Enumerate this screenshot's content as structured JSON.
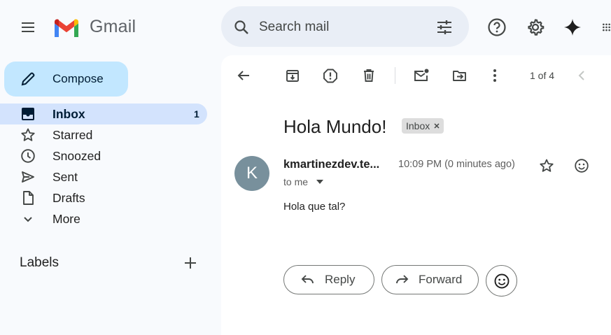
{
  "app": {
    "name": "Gmail"
  },
  "search": {
    "placeholder": "Search mail"
  },
  "compose": {
    "label": "Compose"
  },
  "sidebar": {
    "items": [
      {
        "label": "Inbox",
        "count": "1",
        "icon": "inbox-icon",
        "active": true
      },
      {
        "label": "Starred",
        "icon": "star-icon"
      },
      {
        "label": "Snoozed",
        "icon": "clock-icon"
      },
      {
        "label": "Sent",
        "icon": "send-icon"
      },
      {
        "label": "Drafts",
        "icon": "draft-icon"
      },
      {
        "label": "More",
        "icon": "chevron-down-icon"
      }
    ],
    "labels_title": "Labels"
  },
  "toolbar": {
    "pager": "1 of 4"
  },
  "message": {
    "subject": "Hola Mundo!",
    "label_chip": "Inbox",
    "avatar_letter": "K",
    "sender": "kmartinezdev.te...",
    "time": "10:09 PM (0 minutes ago)",
    "recipient": "to me",
    "body": "Hola que tal?"
  },
  "actions": {
    "reply": "Reply",
    "forward": "Forward"
  },
  "colors": {
    "accent": "#c2e7ff",
    "active_nav": "#d3e3fd",
    "avatar": "#78909c"
  }
}
